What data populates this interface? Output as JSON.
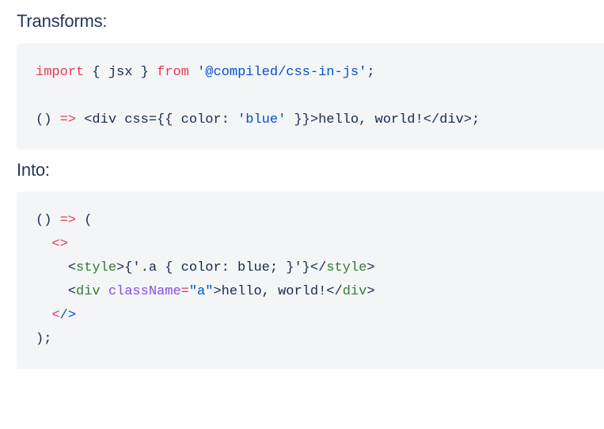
{
  "sections": [
    {
      "heading": "Transforms:",
      "code_lines": [
        {
          "tokens": [
            {
              "text": "import",
              "kind": "keyword"
            },
            {
              "text": " ",
              "kind": "plain"
            },
            {
              "text": "{ jsx }",
              "kind": "plain"
            },
            {
              "text": " ",
              "kind": "plain"
            },
            {
              "text": "from",
              "kind": "keyword"
            },
            {
              "text": " ",
              "kind": "plain"
            },
            {
              "text": "'@compiled/css-in-js'",
              "kind": "string"
            },
            {
              "text": ";",
              "kind": "punct"
            }
          ]
        },
        {
          "blank": true,
          "tokens": []
        },
        {
          "tokens": [
            {
              "text": "()",
              "kind": "punct"
            },
            {
              "text": " ",
              "kind": "plain"
            },
            {
              "text": "=>",
              "kind": "op"
            },
            {
              "text": " ",
              "kind": "plain"
            },
            {
              "text": "<div css={{ color: ",
              "kind": "plain"
            },
            {
              "text": "'blue'",
              "kind": "string"
            },
            {
              "text": " }}>hello, world!</div>;",
              "kind": "plain"
            }
          ]
        }
      ]
    },
    {
      "heading": "Into:",
      "code_lines": [
        {
          "tokens": [
            {
              "text": "()",
              "kind": "punct"
            },
            {
              "text": " ",
              "kind": "plain"
            },
            {
              "text": "=>",
              "kind": "op"
            },
            {
              "text": " ",
              "kind": "plain"
            },
            {
              "text": "(",
              "kind": "punct"
            }
          ]
        },
        {
          "tokens": [
            {
              "text": "  ",
              "kind": "plain"
            },
            {
              "text": "<>",
              "kind": "frag"
            }
          ]
        },
        {
          "tokens": [
            {
              "text": "    ",
              "kind": "plain"
            },
            {
              "text": "<",
              "kind": "punct"
            },
            {
              "text": "style",
              "kind": "tag"
            },
            {
              "text": ">",
              "kind": "punct"
            },
            {
              "text": "{'.a { color: blue; }'}",
              "kind": "plain"
            },
            {
              "text": "</",
              "kind": "punct"
            },
            {
              "text": "style",
              "kind": "tag"
            },
            {
              "text": ">",
              "kind": "punct"
            }
          ]
        },
        {
          "tokens": [
            {
              "text": "    ",
              "kind": "plain"
            },
            {
              "text": "<",
              "kind": "punct"
            },
            {
              "text": "div",
              "kind": "tag"
            },
            {
              "text": " ",
              "kind": "plain"
            },
            {
              "text": "className",
              "kind": "attr"
            },
            {
              "text": "=",
              "kind": "op"
            },
            {
              "text": "\"a\"",
              "kind": "string"
            },
            {
              "text": ">hello, world!",
              "kind": "plain"
            },
            {
              "text": "</",
              "kind": "punct"
            },
            {
              "text": "div",
              "kind": "tag"
            },
            {
              "text": ">",
              "kind": "punct"
            }
          ]
        },
        {
          "tokens": [
            {
              "text": "  ",
              "kind": "plain"
            },
            {
              "text": "<",
              "kind": "frag"
            },
            {
              "text": "/>",
              "kind": "string"
            }
          ]
        },
        {
          "tokens": [
            {
              "text": ");",
              "kind": "punct"
            }
          ]
        }
      ]
    }
  ],
  "colors": {
    "page_background": "#ffffff",
    "code_background": "#f4f5f7",
    "heading_text": "#253858",
    "code_text": "#172b4d",
    "keyword": "#e03e52",
    "string": "#0052cc",
    "tag": "#2f7d32",
    "attribute": "#8250df",
    "operator": "#e03e52"
  }
}
